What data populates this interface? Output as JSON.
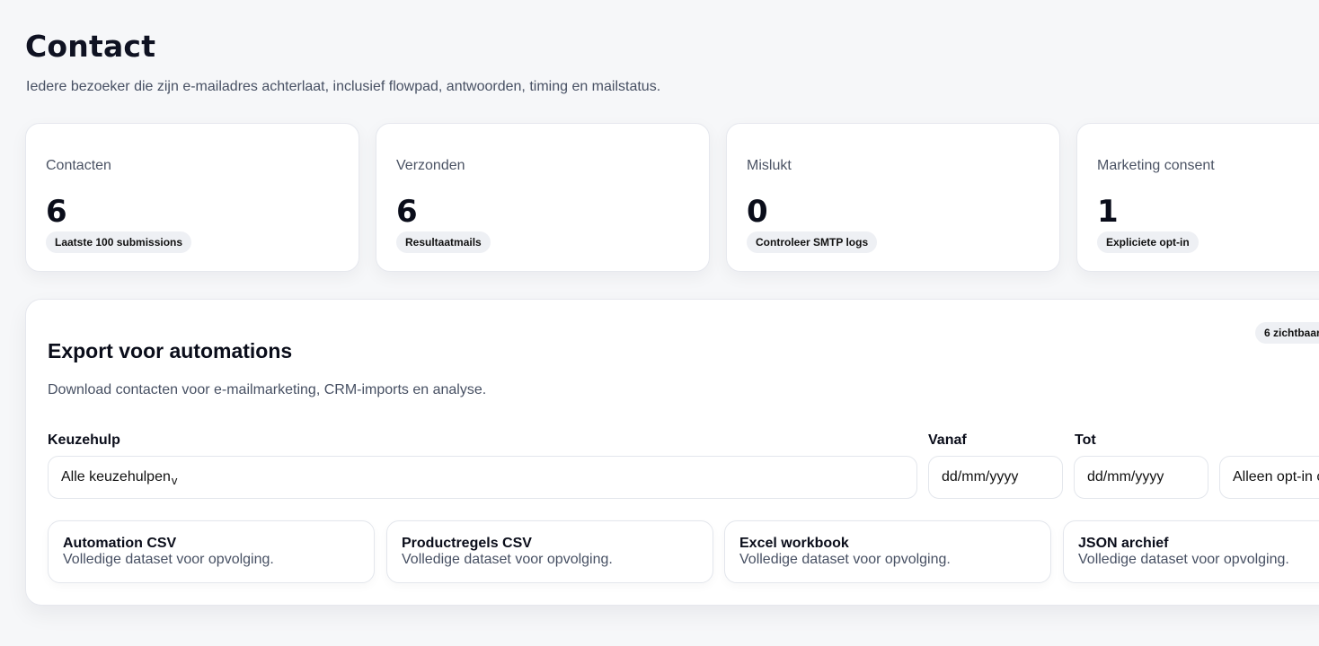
{
  "header": {
    "title": "Contact",
    "subtitle": "Iedere bezoeker die zijn e-mailadres achterlaat, inclusief flowpad, antwoorden, timing en mailstatus."
  },
  "stats": [
    {
      "label": "Contacten",
      "value": "6",
      "pill": "Laatste 100 submissions"
    },
    {
      "label": "Verzonden",
      "value": "6",
      "pill": "Resultaatmails"
    },
    {
      "label": "Mislukt",
      "value": "0",
      "pill": "Controleer SMTP logs"
    },
    {
      "label": "Marketing consent",
      "value": "1",
      "pill": "Expliciete opt-in"
    }
  ],
  "export": {
    "badge": "6 zichtbaar",
    "title": "Export voor automations",
    "description": "Download contacten voor e-mailmarketing, CRM-imports en analyse.",
    "filters": {
      "keuzehulp_label": "Keuzehulp",
      "keuzehulp_value": "Alle keuzehulpen",
      "keuzehulp_chevron": "v",
      "vanaf_label": "Vanaf",
      "vanaf_placeholder": "dd/mm/yyyy",
      "tot_label": "Tot",
      "tot_placeholder": "dd/mm/yyyy",
      "consent_value": "Alleen opt-in c"
    },
    "options": [
      {
        "title": "Automation CSV",
        "desc": "Volledige dataset voor opvolging."
      },
      {
        "title": "Productregels CSV",
        "desc": "Volledige dataset voor opvolging."
      },
      {
        "title": "Excel workbook",
        "desc": "Volledige dataset voor opvolging."
      },
      {
        "title": "JSON archief",
        "desc": "Volledige dataset voor opvolging."
      }
    ]
  }
}
